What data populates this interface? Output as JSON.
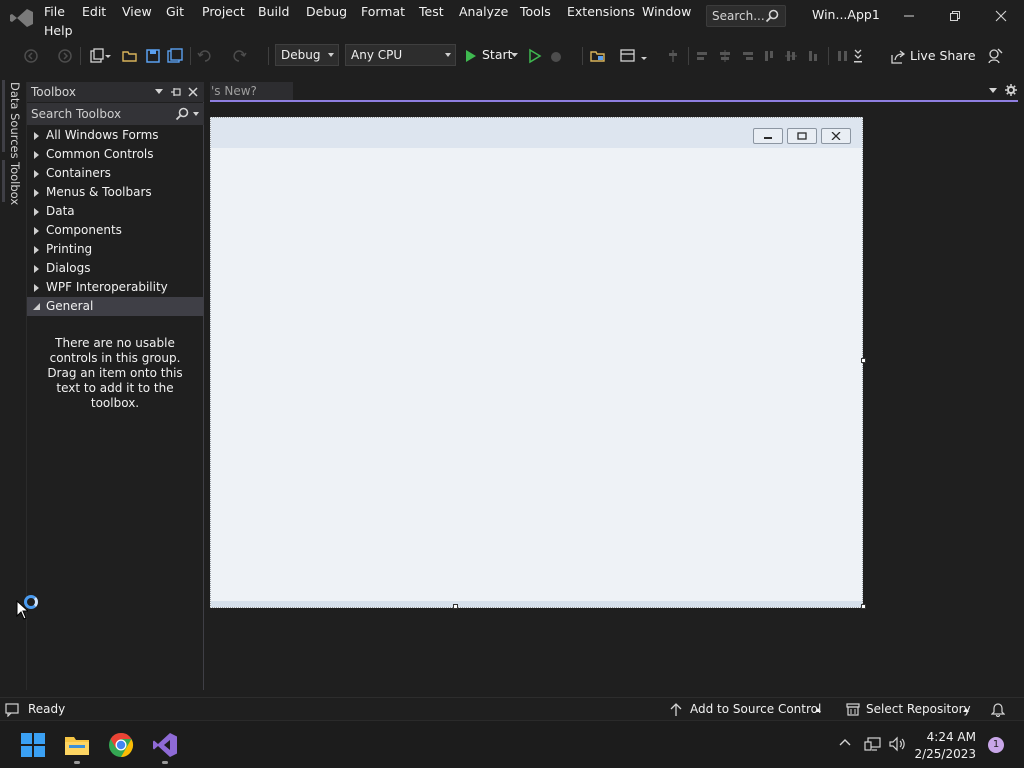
{
  "menu": {
    "items": [
      "File",
      "Edit",
      "View",
      "Git",
      "Project",
      "Build",
      "Debug",
      "Format",
      "Test",
      "Analyze",
      "Tools",
      "Extensions",
      "Window",
      "Help"
    ],
    "search_placeholder": "Search...",
    "solution_name": "Win...App1"
  },
  "toolbar": {
    "configuration": "Debug",
    "platform": "Any CPU",
    "start_label": "Start",
    "live_share_label": "Live Share"
  },
  "side_tabs": {
    "data_sources": "Data Sources",
    "toolbox": "Toolbox"
  },
  "toolbox": {
    "title": "Toolbox",
    "search_placeholder": "Search Toolbox",
    "groups": [
      {
        "label": "All Windows Forms",
        "expanded": false
      },
      {
        "label": "Common Controls",
        "expanded": false
      },
      {
        "label": "Containers",
        "expanded": false
      },
      {
        "label": "Menus & Toolbars",
        "expanded": false
      },
      {
        "label": "Data",
        "expanded": false
      },
      {
        "label": "Components",
        "expanded": false
      },
      {
        "label": "Printing",
        "expanded": false
      },
      {
        "label": "Dialogs",
        "expanded": false
      },
      {
        "label": "WPF Interoperability",
        "expanded": false
      },
      {
        "label": "General",
        "expanded": true
      }
    ],
    "empty_message": "There are no usable controls in this group. Drag an item onto this text to add it to the toolbox."
  },
  "document": {
    "tab_label": "'s New?"
  },
  "statusbar": {
    "status": "Ready",
    "add_source_control": "Add to Source Control",
    "select_repository": "Select Repository"
  },
  "taskbar": {
    "time": "4:24 AM",
    "date": "2/25/2023",
    "notification_count": "1"
  },
  "colors": {
    "accent": "#8f7fe0",
    "start_green": "#3fb950",
    "vs_purple": "#8e6ad6"
  }
}
